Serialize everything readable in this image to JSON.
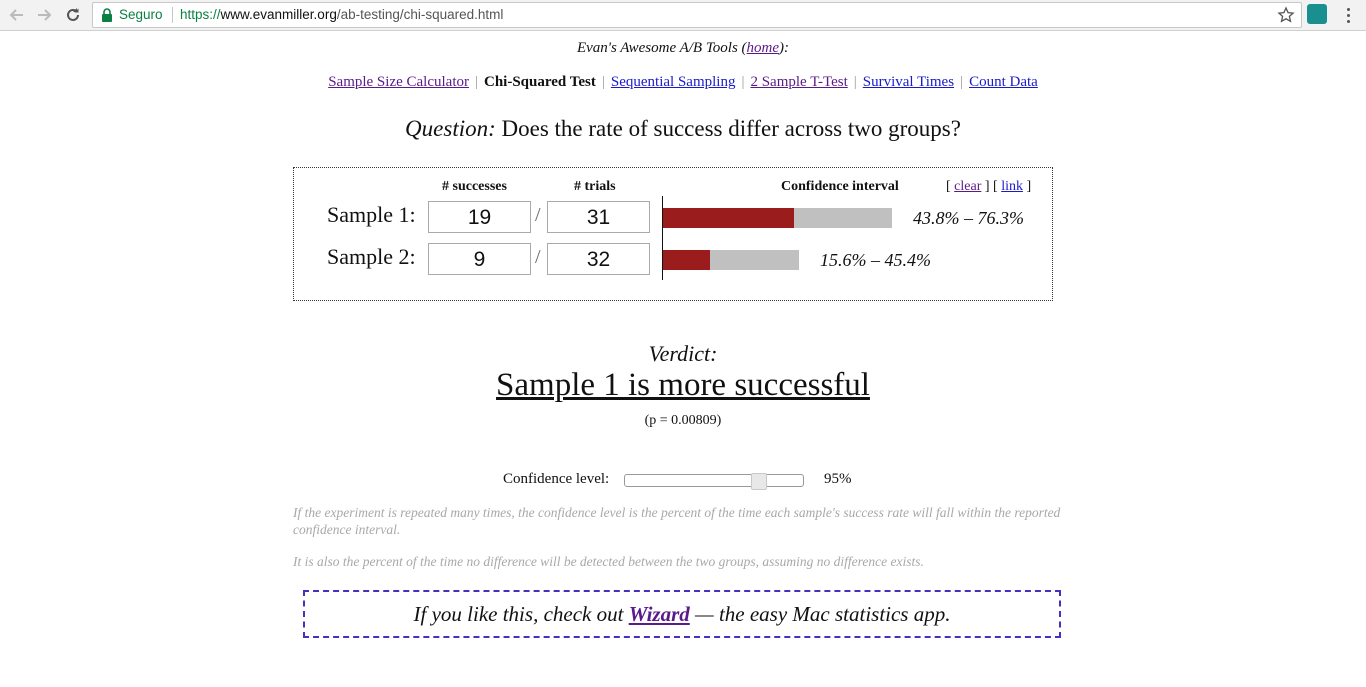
{
  "browser": {
    "secure_label": "Seguro",
    "url_scheme": "https://",
    "url_host": "www.evanmiller.org",
    "url_path": "/ab-testing/chi-squared.html"
  },
  "header": {
    "tools_prefix": "Evan's Awesome A/B Tools (",
    "home_link": "home",
    "tools_suffix": "):"
  },
  "nav": {
    "items": [
      {
        "label": "Sample Size Calculator",
        "link": true,
        "visited": true
      },
      {
        "label": "Chi-Squared Test",
        "link": false
      },
      {
        "label": "Sequential Sampling",
        "link": true
      },
      {
        "label": "2 Sample T-Test",
        "link": true,
        "visited": true
      },
      {
        "label": "Survival Times",
        "link": true
      },
      {
        "label": "Count Data",
        "link": true
      }
    ],
    "separator": "|"
  },
  "question": {
    "label": "Question:",
    "text": "Does the rate of success differ across two groups?"
  },
  "calculator": {
    "col_successes": "# successes",
    "col_trials": "# trials",
    "col_ci": "Confidence interval",
    "clear_label": "clear",
    "link_label": "link",
    "samples": [
      {
        "label": "Sample 1:",
        "successes": "19",
        "trials": "31",
        "ci_text": "43.8% – 76.3%",
        "ci_low": 0.438,
        "ci_high": 0.763
      },
      {
        "label": "Sample 2:",
        "successes": "9",
        "trials": "32",
        "ci_text": "15.6% – 45.4%",
        "ci_low": 0.156,
        "ci_high": 0.454
      }
    ]
  },
  "verdict": {
    "label": "Verdict:",
    "text": "Sample 1 is more successful",
    "p_value": "(p = 0.00809)"
  },
  "confidence": {
    "label": "Confidence level:",
    "value": "95%",
    "slider_fraction": 0.78
  },
  "notes": [
    "If the experiment is repeated many times, the confidence level is the percent of the time each sample's success rate will fall within the reported confidence interval.",
    "It is also the percent of the time no difference will be detected between the two groups, assuming no difference exists."
  ],
  "promo": {
    "prefix": "If you like this, check out ",
    "link": "Wizard",
    "suffix": " — the easy Mac statistics app."
  },
  "colors": {
    "ci_fill": "#9b1c1c",
    "ci_track": "#c0c0c0",
    "visited_link": "#5a1a8a",
    "link": "#1a1acc",
    "promo_border": "#4a2fbf"
  }
}
